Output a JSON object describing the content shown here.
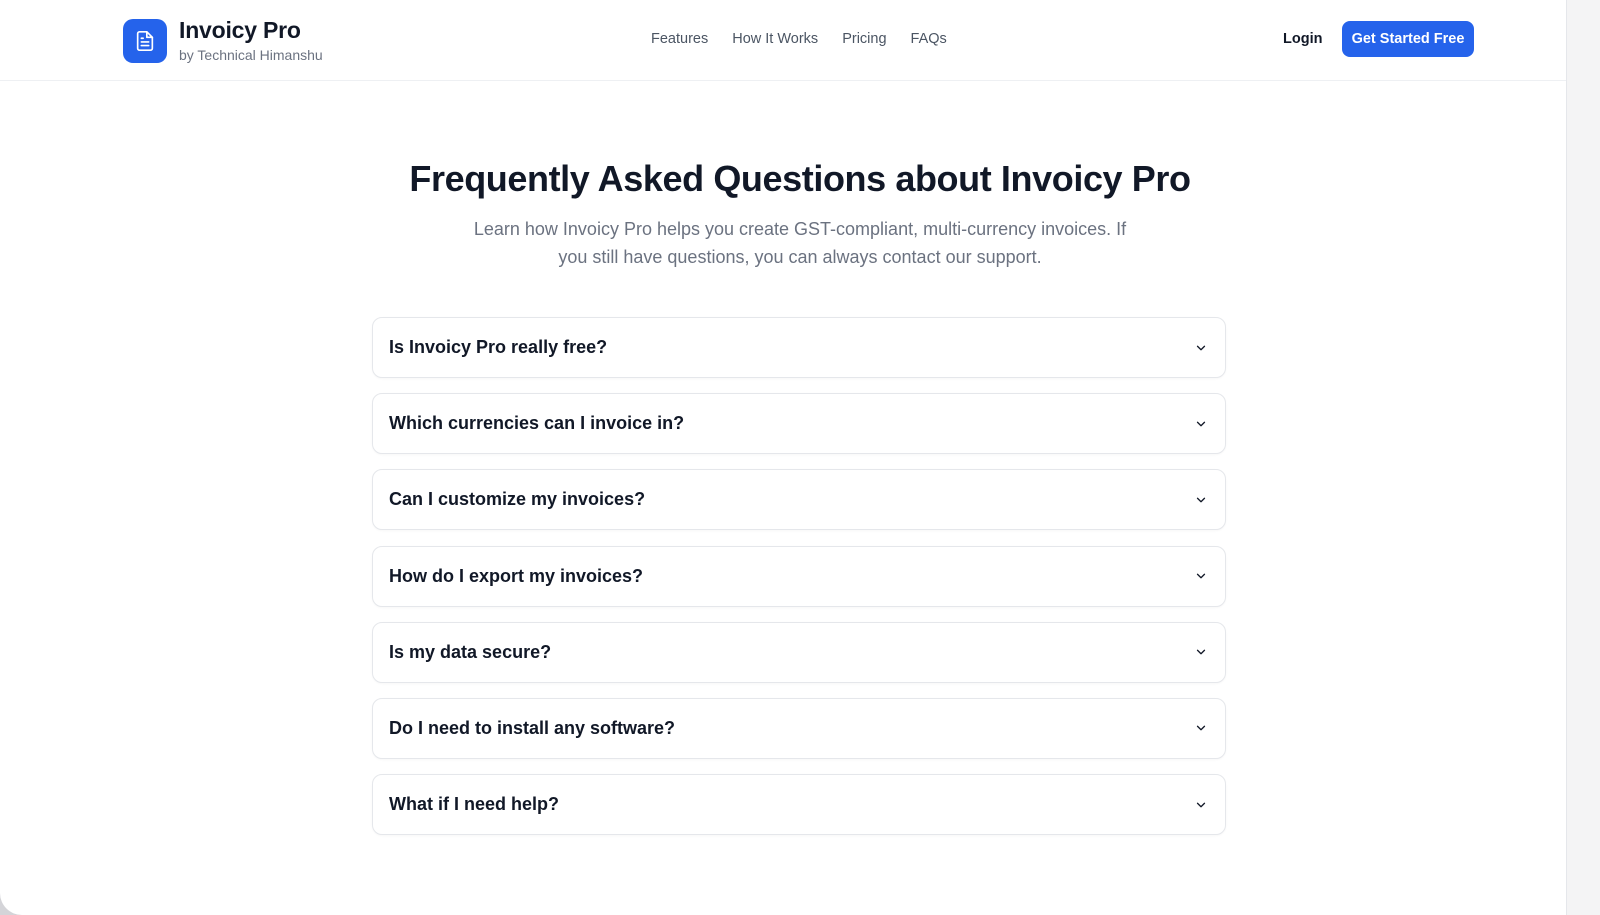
{
  "brand": {
    "name": "Invoicy Pro",
    "tagline": "by Technical Himanshu",
    "logo_icon": "document-icon",
    "accent": "#2563eb"
  },
  "nav": {
    "links": [
      "Features",
      "How It Works",
      "Pricing",
      "FAQs"
    ],
    "login_label": "Login",
    "cta_label": "Get Started Free"
  },
  "hero": {
    "title": "Frequently Asked Questions about Invoicy Pro",
    "subtitle": "Learn how Invoicy Pro helps you create GST-compliant, multi-currency invoices. If you still have questions, you can always contact our support."
  },
  "faq": {
    "expand_icon": "chevron-down-icon",
    "items": [
      "Is Invoicy Pro really free?",
      "Which currencies can I invoice in?",
      "Can I customize my invoices?",
      "How do I export my invoices?",
      "Is my data secure?",
      "Do I need to install any software?",
      "What if I need help?"
    ]
  }
}
